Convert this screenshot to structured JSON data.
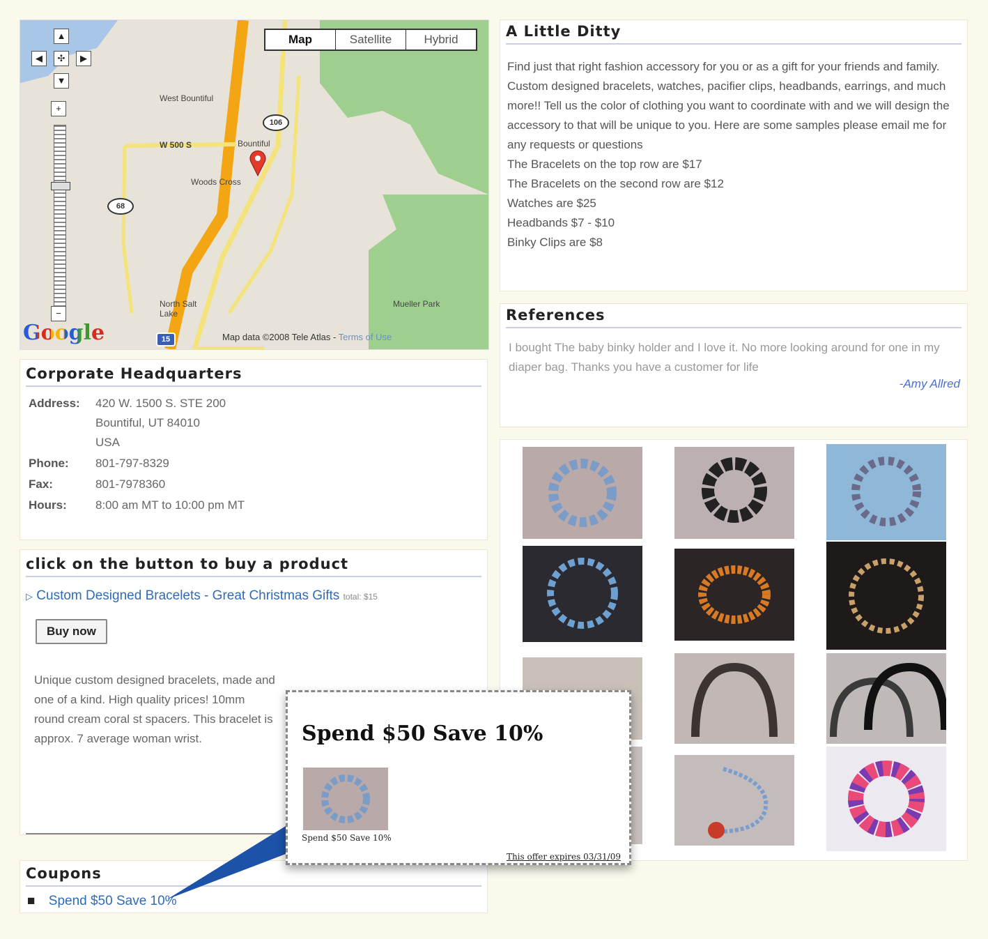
{
  "map": {
    "types": [
      "Map",
      "Satellite",
      "Hybrid"
    ],
    "attribution": "Map data ©2008 Tele Atlas",
    "terms": "Terms of Use",
    "logo": "Google",
    "labels": [
      "West Bountiful",
      "Bountiful",
      "Woods Cross",
      "North Salt Lake",
      "Mueller Park",
      "W 500 S"
    ],
    "shields": [
      "106",
      "68",
      "15"
    ]
  },
  "hq": {
    "title": "Corporate Headquarters",
    "address_label": "Address:",
    "address": [
      "420 W. 1500 S. STE 200",
      "Bountiful, UT 84010",
      "USA"
    ],
    "phone_label": "Phone:",
    "phone": "801-797-8329",
    "fax_label": "Fax:",
    "fax": "801-7978360",
    "hours_label": "Hours:",
    "hours": "8:00 am MT to 10:00 pm MT"
  },
  "buy": {
    "title": "click on the button to buy a product",
    "product_link": "Custom Designed Bracelets - Great Christmas Gifts",
    "total": "total: $15",
    "button": "Buy now",
    "description": "Unique custom designed bracelets, made and one of a kind. High quality prices! 10mm round cream coral st spacers. This bracelet is approx. 7 average woman wrist."
  },
  "coupons": {
    "title": "Coupons",
    "items": [
      "Spend $50 Save 10%"
    ]
  },
  "coupon_popup": {
    "headline": "Spend $50 Save 10%",
    "caption": "Spend $50 Save 10%",
    "expiry": "This offer expires 03/31/09"
  },
  "ditty": {
    "title": "A Little Ditty",
    "paragraph": "Find just that right fashion accessory for you or as a gift for your friends and family. Custom designed bracelets, watches, pacifier clips, headbands, earrings, and much more!! Tell us the color of clothing you want to coordinate with and we will design the accessory to that will be unique to you. Here are some samples please email me for any requests or questions",
    "prices": [
      "The Bracelets on the top row are $17",
      "The Bracelets on the second row are $12",
      "Watches are $25",
      "Headbands $7 - $10",
      "Binky Clips are $8"
    ]
  },
  "references": {
    "title": "References",
    "quote": "I bought The baby binky holder and I love it. No more looking around for one in my diaper bag. Thanks you have a customer for life",
    "author": "-Amy Allred"
  }
}
